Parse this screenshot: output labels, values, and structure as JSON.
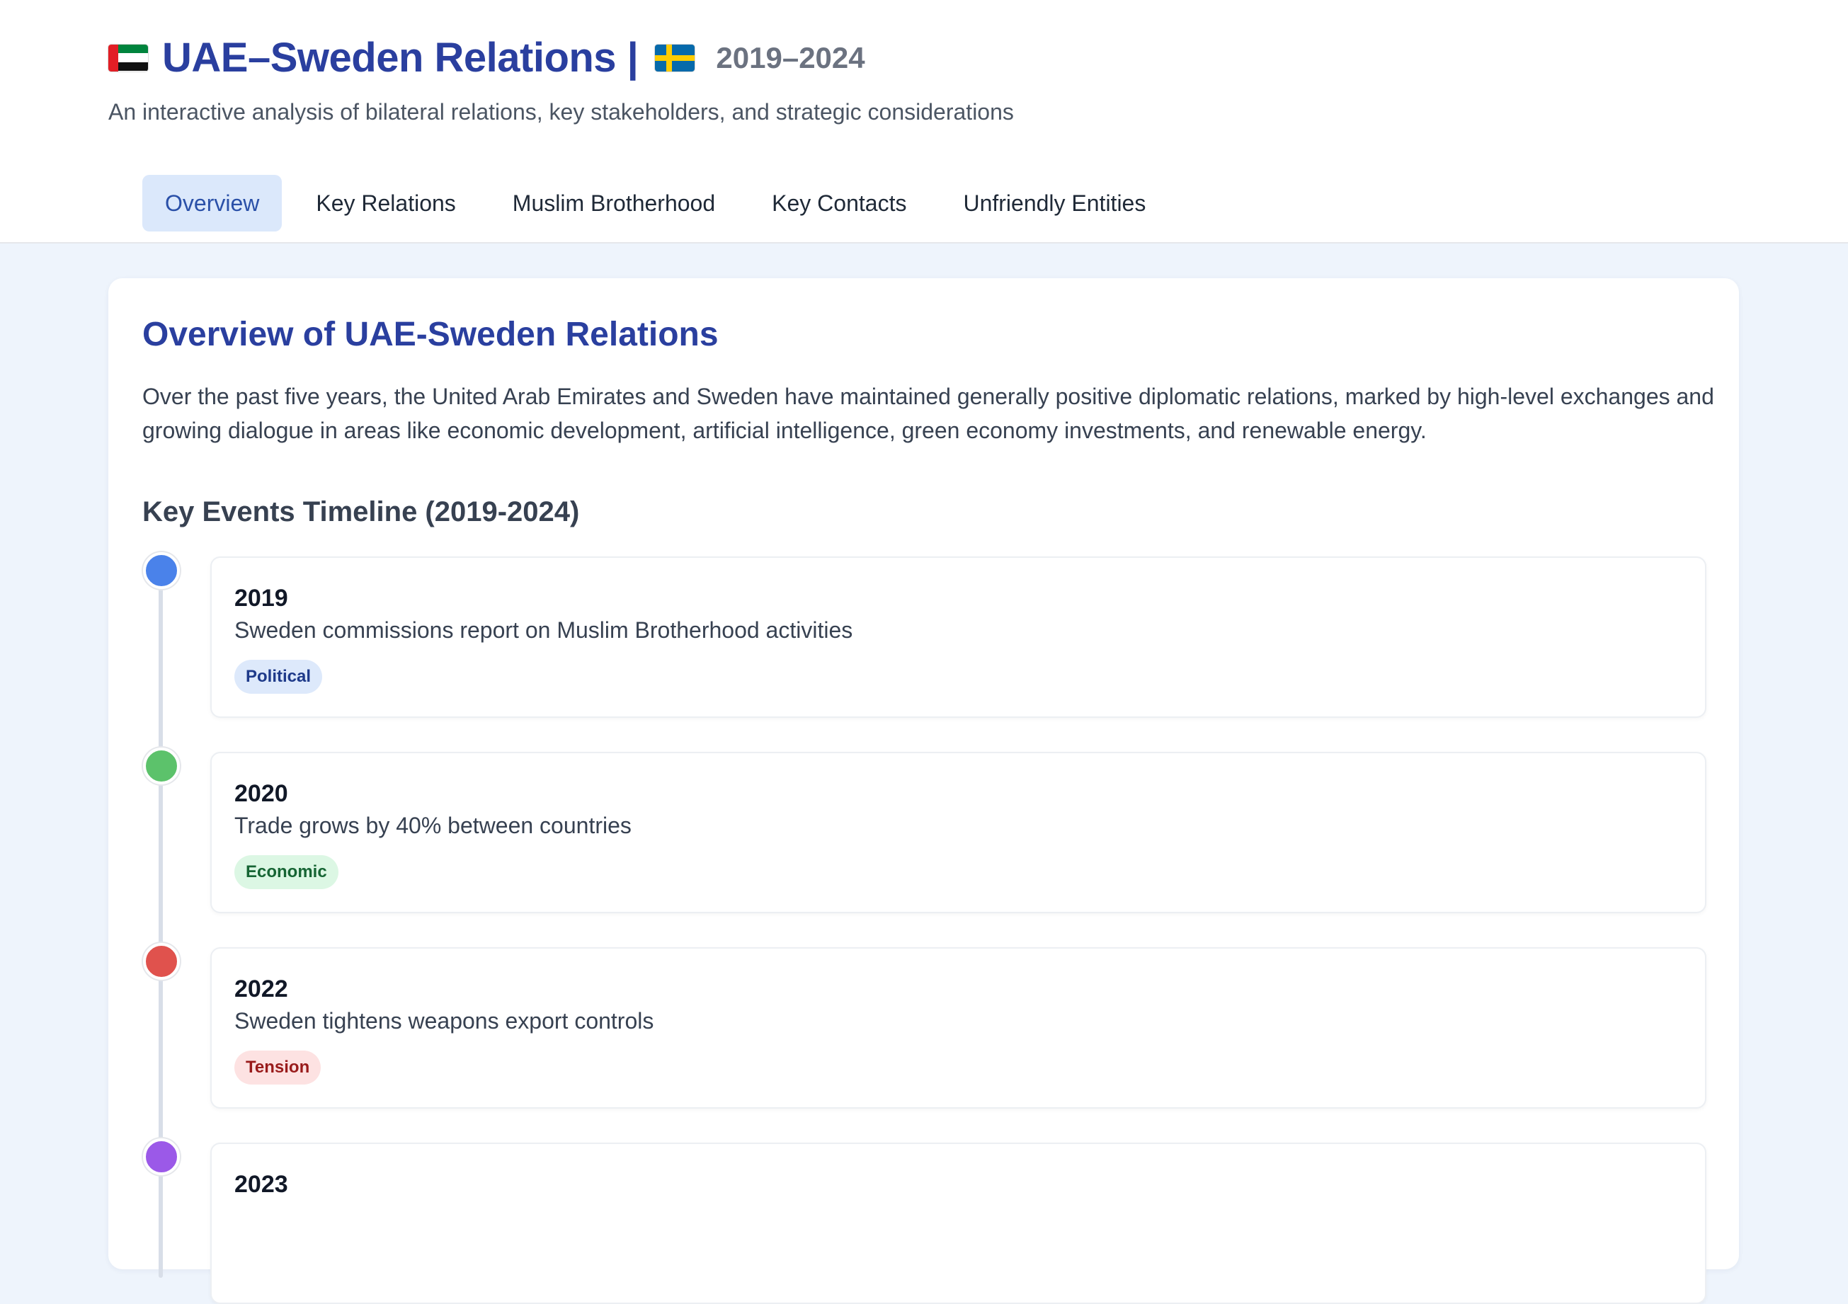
{
  "header": {
    "title": "UAE–Sweden Relations |",
    "year_range": "2019–2024",
    "subtitle": "An interactive analysis of bilateral relations, key stakeholders, and strategic considerations"
  },
  "tabs": [
    {
      "label": "Overview",
      "active": true
    },
    {
      "label": "Key Relations",
      "active": false
    },
    {
      "label": "Muslim Brotherhood",
      "active": false
    },
    {
      "label": "Key Contacts",
      "active": false
    },
    {
      "label": "Unfriendly Entities",
      "active": false
    }
  ],
  "overview": {
    "title": "Overview of UAE-Sweden Relations",
    "intro": "Over the past five years, the United Arab Emirates and Sweden have maintained generally positive diplomatic relations, marked by high-level exchanges and growing dialogue in areas like economic development, artificial intelligence, green economy investments, and renewable energy.",
    "timeline_title": "Key Events Timeline (2019-2024)"
  },
  "timeline": [
    {
      "year": "2019",
      "text": "Sweden commissions report on Muslim Brotherhood activities",
      "tag": "Political",
      "dot_color": "#4a82ea",
      "tag_bg": "#dde9fb",
      "tag_color": "#1e3a8a"
    },
    {
      "year": "2020",
      "text": "Trade grows by 40% between countries",
      "tag": "Economic",
      "dot_color": "#5cc26b",
      "tag_bg": "#dcf7e4",
      "tag_color": "#166534"
    },
    {
      "year": "2022",
      "text": "Sweden tightens weapons export controls",
      "tag": "Tension",
      "dot_color": "#e0524d",
      "tag_bg": "#fde2e2",
      "tag_color": "#991b1b"
    },
    {
      "year": "2023",
      "text": "",
      "tag": "",
      "dot_color": "#9b59e8",
      "tag_bg": "#efe3fd",
      "tag_color": "#5b21b6"
    }
  ]
}
